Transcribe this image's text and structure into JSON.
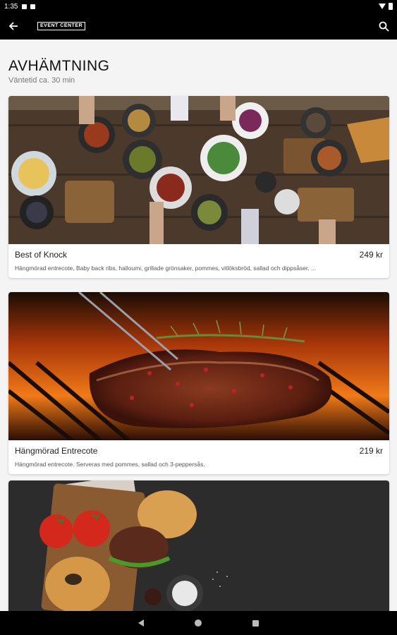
{
  "status_bar": {
    "time": "1:35"
  },
  "app_bar": {
    "logo_text": "EVENT CENTER"
  },
  "header": {
    "title": "AVHÄMTNING",
    "subtitle": "Väntetid ca. 30 min"
  },
  "menu_items": [
    {
      "name": "Best of Knock",
      "price": "249 kr",
      "description": "Hängmörad entrecote, Baby back ribs, halloumi, grillade grönsaker, pommes, vitlöksbröd, sallad och dippsåser. ..."
    },
    {
      "name": "Hängmörad Entrecote",
      "price": "219 kr",
      "description": "Hängmörad entrecote. Serveras med pommes, sallad och 3-peppersås."
    },
    {
      "name": "",
      "price": "",
      "description": ""
    }
  ]
}
